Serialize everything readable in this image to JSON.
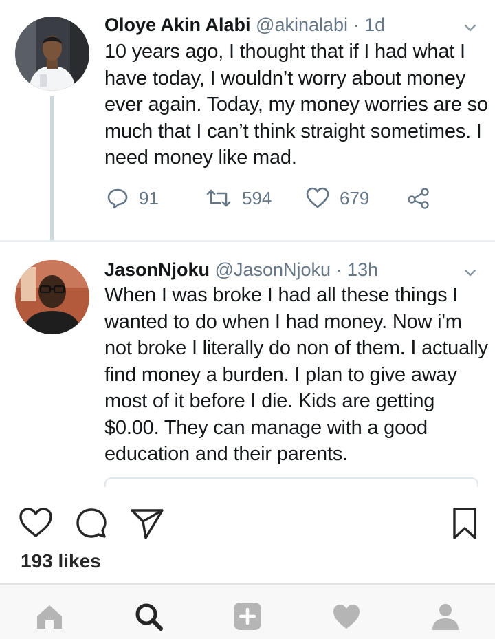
{
  "tweets": [
    {
      "name": "Oloye Akin Alabi",
      "handle": "@akinalabi",
      "separator": "·",
      "time": "1d",
      "text": "10 years ago, I thought that if I had what I have today, I wouldn’t worry about money ever again. Today, my money worries are so much that I can’t think straight sometimes. I need money like mad.",
      "replies": "91",
      "retweets": "594",
      "likes": "679"
    },
    {
      "name": "JasonNjoku",
      "handle": "@JasonNjoku",
      "separator": "·",
      "time": "13h",
      "text": "When I was broke I had all these things I wanted to do when I had money. Now i'm not broke I literally do non of them. I actually find money a burden. I plan to give away most of it before I die. Kids are getting $0.00. They can manage with a good education and their parents."
    }
  ],
  "post": {
    "likes_label": "193 likes"
  },
  "nav": [
    "home-icon",
    "search-icon",
    "add-icon",
    "heart-icon",
    "profile-icon"
  ],
  "colors": {
    "text": "#14171a",
    "secondary": "#657786",
    "divider": "#e6ecf0",
    "nav_bg": "#f8f8f8",
    "nav_icon": "#b5b5b5"
  }
}
